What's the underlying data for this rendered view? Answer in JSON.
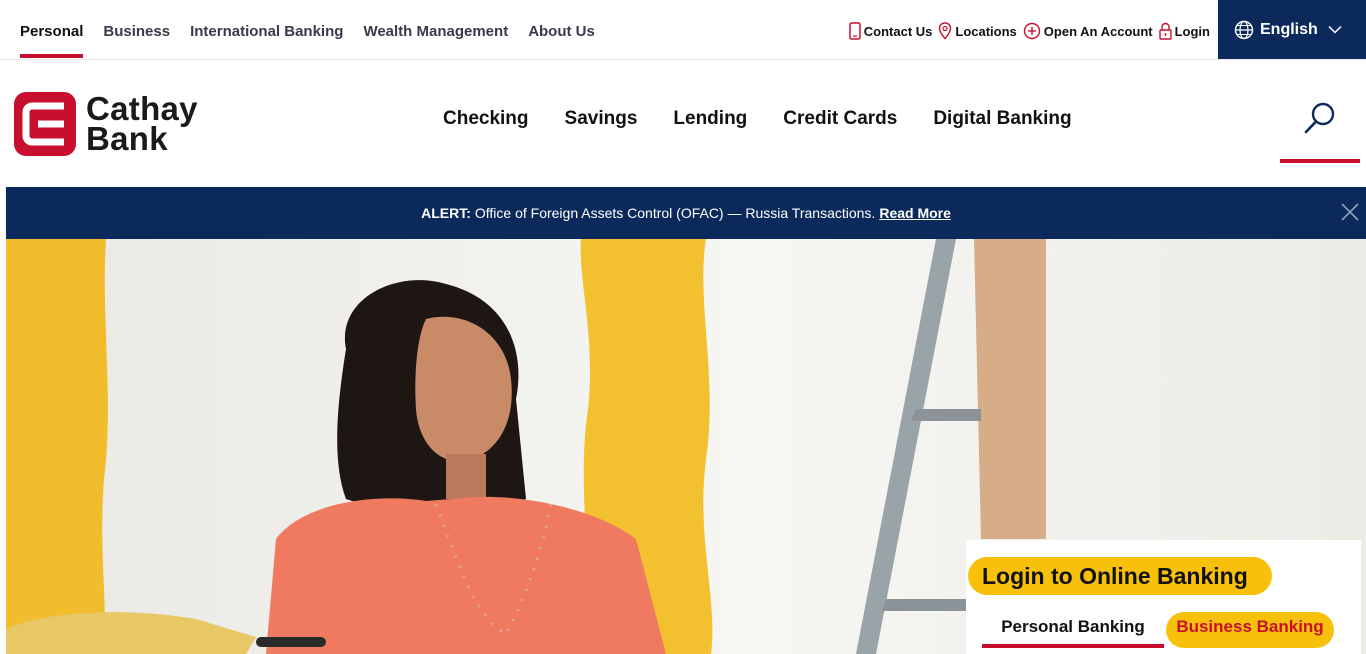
{
  "utility": {
    "segments": [
      {
        "label": "Personal",
        "active": true
      },
      {
        "label": "Business"
      },
      {
        "label": "International Banking"
      },
      {
        "label": "Wealth Management"
      },
      {
        "label": "About Us"
      }
    ],
    "links": [
      {
        "label": "Contact Us",
        "icon": "phone-icon"
      },
      {
        "label": "Locations",
        "icon": "location-pin-icon"
      },
      {
        "label": "Open An Account",
        "icon": "plus-circle-icon"
      },
      {
        "label": "Login",
        "icon": "lock-icon"
      }
    ],
    "language": {
      "label": "English",
      "icon": "globe-icon"
    }
  },
  "brand": {
    "line1": "Cathay",
    "line2": "Bank"
  },
  "main_nav": {
    "items": [
      "Checking",
      "Savings",
      "Lending",
      "Credit Cards",
      "Digital Banking"
    ]
  },
  "alert": {
    "prefix": "ALERT:",
    "text": "Office of Foreign Assets Control (OFAC) — Russia Transactions.",
    "link": "Read More"
  },
  "login": {
    "title": "Login to Online Banking",
    "tabs": [
      "Personal Banking",
      "Business Banking"
    ]
  },
  "colors": {
    "brand_red": "#c8102e",
    "navy": "#0b2a5b",
    "yellow": "#f7c10b"
  }
}
